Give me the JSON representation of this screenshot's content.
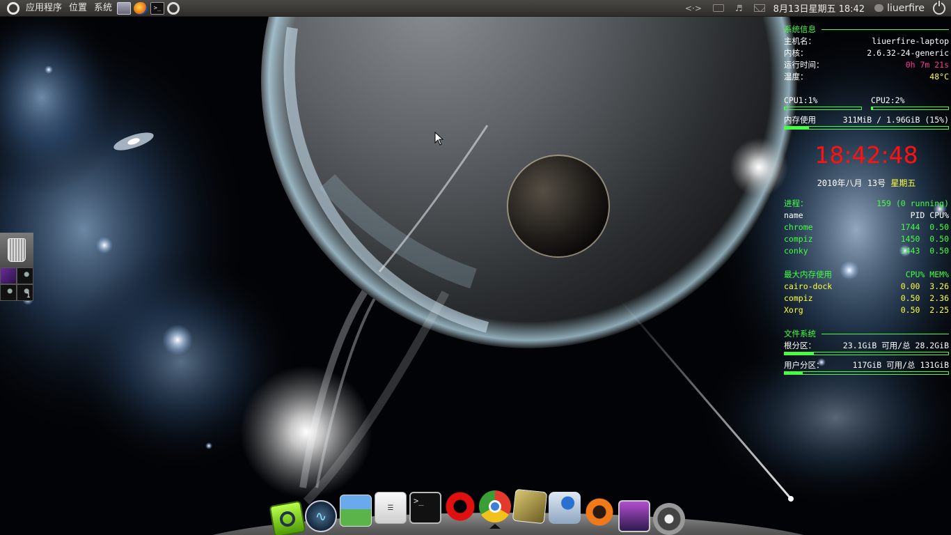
{
  "top_panel": {
    "menus": [
      "应用程序",
      "位置",
      "系统"
    ],
    "launchers": [
      "system-monitor-icon",
      "firefox-icon",
      "terminal-icon",
      "chrome-icon"
    ],
    "tray": [
      "network-icon",
      "keyboard-icon",
      "volume-icon",
      "mail-icon"
    ],
    "clock": "8月13日星期五 18:42",
    "user": "liuerfire"
  },
  "conky": {
    "sysinfo": {
      "title": "系统信息",
      "hostname_label": "主机名：",
      "hostname": "liuerfire-laptop",
      "kernel_label": "内核：",
      "kernel": "2.6.32-24-generic",
      "uptime_label": "运行时间：",
      "uptime": "0h 7m 21s",
      "temp_label": "温度：",
      "temp": "48°C"
    },
    "cpu1": {
      "label": "CPU1:1%",
      "usage": 0.01
    },
    "cpu2": {
      "label": "CPU2:2%",
      "usage": 0.02
    },
    "memory": {
      "label": "内存使用",
      "value": "311MiB / 1.96GiB (15%)",
      "usage": 0.15
    },
    "clock": "18:42:48",
    "date": {
      "text": "2010年八月 13号",
      "weekday": "星期五"
    },
    "processes": {
      "title": "进程：",
      "summary": "159 (0 running)",
      "headers": {
        "name": "name",
        "pid": "PID",
        "cpu": "CPU%"
      },
      "rows": [
        {
          "name": "chrome",
          "pid": "1744",
          "cpu": "0.50"
        },
        {
          "name": "compiz",
          "pid": "1450",
          "cpu": "0.50"
        },
        {
          "name": "conky",
          "pid": "1443",
          "cpu": "0.50"
        }
      ]
    },
    "top_mem": {
      "title": "最大内存使用",
      "headers": "CPU% MEM%",
      "rows": [
        {
          "name": "cairo-dock",
          "cpu": "0.00",
          "mem": "3.26"
        },
        {
          "name": "compiz",
          "cpu": "0.50",
          "mem": "2.36"
        },
        {
          "name": "Xorg",
          "cpu": "0.50",
          "mem": "2.25"
        }
      ]
    },
    "filesystem": {
      "title": "文件系统",
      "root_label": "根分区：",
      "root_value": "23.1GiB 可用/总 28.2GiB",
      "root_used": 0.18,
      "home_label": "用户分区：",
      "home_value": "117GiB 可用/总 131GiB",
      "home_used": 0.11
    }
  },
  "left_widget": {
    "icons": [
      "trash-icon",
      "workspace-switcher-icon"
    ],
    "workspace_number": "1"
  },
  "dock": {
    "icons": [
      "ubuntu-tweak-icon",
      "system-monitor-icon",
      "desktop-icon",
      "file-manager-icon",
      "terminal-icon",
      "opera-icon",
      "chrome-icon",
      "image-viewer-icon",
      "network-manager-icon",
      "ubuntu-icon",
      "screenshot-icon",
      "shutdown-icon"
    ],
    "terminal_prompt": ">_"
  }
}
